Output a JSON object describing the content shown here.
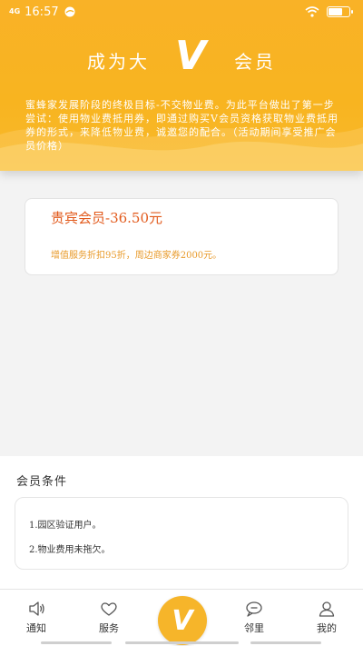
{
  "status_bar": {
    "network": "4G",
    "time": "16:57"
  },
  "hero": {
    "title_left": "成为大",
    "title_v": "V",
    "title_right": "会员",
    "description": "蜜蜂家发展阶段的终极目标-不交物业费。为此平台做出了第一步尝试：使用物业费抵用券，即通过购买V会员资格获取物业费抵用券的形式，来降低物业费，诚邀您的配合。（活动期间享受推广会员价格）"
  },
  "member_card": {
    "title": "贵宾会员-36.50元",
    "subtitle": "增值服务折扣95折，周边商家券2000元。"
  },
  "conditions": {
    "heading": "会员条件",
    "items": [
      "1.园区验证用户。",
      "2.物业费用未拖欠。"
    ]
  },
  "bottom_nav": {
    "items": [
      {
        "label": "通知",
        "icon": "speaker-icon"
      },
      {
        "label": "服务",
        "icon": "heart-icon"
      },
      {
        "label": "邻里",
        "icon": "chat-bubble-icon"
      },
      {
        "label": "我的",
        "icon": "person-icon"
      }
    ],
    "center_label": "V"
  },
  "colors": {
    "brand": "#f8b420",
    "price_text": "#e25a1c",
    "subtitle_text": "#e89a2a"
  }
}
